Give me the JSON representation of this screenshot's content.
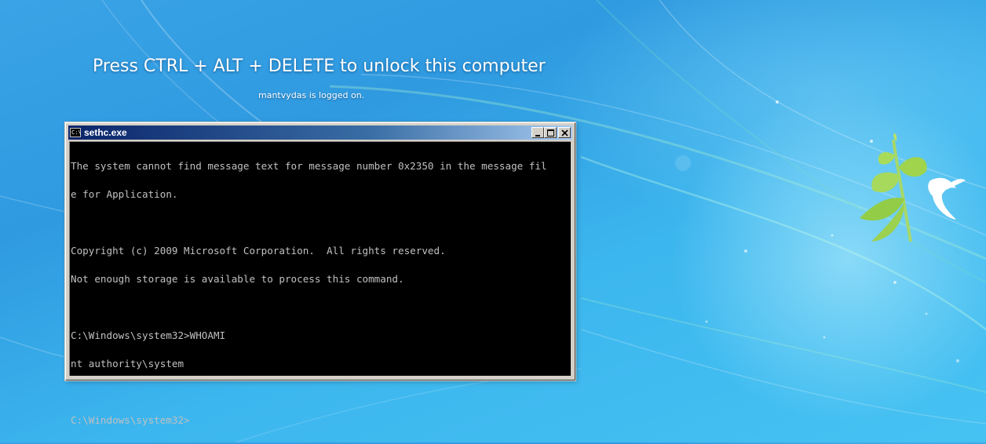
{
  "lock_screen": {
    "title": "Press CTRL + ALT + DELETE to unlock this computer",
    "subtitle": "mantvydas is logged on."
  },
  "window": {
    "title": "sethc.exe",
    "icon": "cmd-prompt-icon",
    "buttons": {
      "minimize": "minimize-icon",
      "maximize": "maximize-icon",
      "close": "close-icon"
    }
  },
  "console": {
    "lines": [
      "The system cannot find message text for message number 0x2350 in the message fil",
      "e for Application.",
      "",
      "Copyright (c) 2009 Microsoft Corporation.  All rights reserved.",
      "Not enough storage is available to process this command.",
      "",
      "C:\\Windows\\system32>WHOAMI",
      "nt authority\\system",
      "",
      "C:\\Windows\\system32>"
    ]
  },
  "colors": {
    "desktop": "#2f9ae0",
    "console_bg": "#000000",
    "console_fg": "#c0c0c0",
    "titlebar_start": "#0a246a",
    "titlebar_end": "#a6caf0"
  }
}
